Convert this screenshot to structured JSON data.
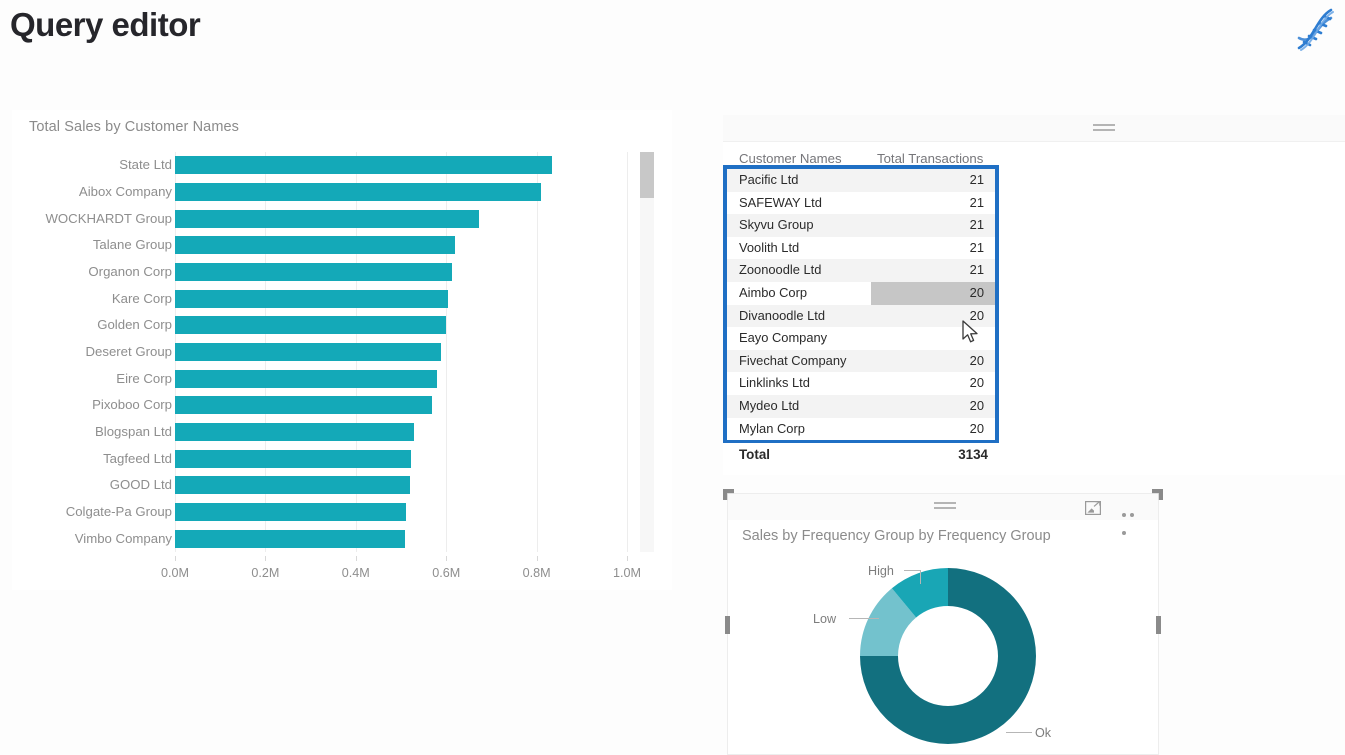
{
  "header": {
    "title": "Query editor",
    "logo_icon": "dna-helix-icon",
    "logo_color": "#2e7dd1"
  },
  "bar_panel": {
    "title": "Total Sales by Customer Names",
    "scrollbar_icon": "vertical-scrollbar"
  },
  "table_panel": {
    "columns": [
      "Customer Names",
      "Total Transactions"
    ],
    "rows": [
      {
        "name": "Pacific Ltd",
        "value": "21",
        "highlighted": false
      },
      {
        "name": "SAFEWAY Ltd",
        "value": "21",
        "highlighted": false
      },
      {
        "name": "Skyvu Group",
        "value": "21",
        "highlighted": false
      },
      {
        "name": "Voolith Ltd",
        "value": "21",
        "highlighted": false
      },
      {
        "name": "Zoonoodle Ltd",
        "value": "21",
        "highlighted": false
      },
      {
        "name": "Aimbo Corp",
        "value": "20",
        "highlighted": true
      },
      {
        "name": "Divanoodle Ltd",
        "value": "20",
        "highlighted": false
      },
      {
        "name": "Eayo Company",
        "value": "",
        "highlighted": false
      },
      {
        "name": "Fivechat Company",
        "value": "20",
        "highlighted": false
      },
      {
        "name": "Linklinks Ltd",
        "value": "20",
        "highlighted": false
      },
      {
        "name": "Mydeo Ltd",
        "value": "20",
        "highlighted": false
      },
      {
        "name": "Mylan Corp",
        "value": "20",
        "highlighted": false
      }
    ],
    "total_label": "Total",
    "total_value": "3134",
    "focus_border_color": "#1f6fc4",
    "drag_handle_icon": "drag-handle-icon",
    "cursor_icon": "mouse-pointer-icon"
  },
  "donut_panel": {
    "title": "Sales by Frequency Group by Frequency Group",
    "drag_handle_icon": "drag-handle-icon",
    "focus_mode_icon": "focus-mode-icon",
    "more_options_icon": "more-options-icon"
  },
  "chart_data": [
    {
      "type": "bar",
      "title": "Total Sales by Customer Names",
      "orientation": "horizontal",
      "xlabel": "",
      "ylabel": "",
      "xlim": [
        0,
        1000000
      ],
      "xticks": [
        0,
        200000,
        400000,
        600000,
        800000,
        1000000
      ],
      "xticklabels": [
        "0.0M",
        "0.2M",
        "0.4M",
        "0.6M",
        "0.8M",
        "1.0M"
      ],
      "grid": true,
      "legend": "none",
      "bar_color": "#14a9b8",
      "categories": [
        "State Ltd",
        "Aibox Company",
        "WOCKHARDT Group",
        "Talane Group",
        "Organon Corp",
        "Kare Corp",
        "Golden Corp",
        "Deseret Group",
        "Eire Corp",
        "Pixoboo Corp",
        "Blogspan Ltd",
        "Tagfeed Ltd",
        "GOOD Ltd",
        "Colgate-Pa Group",
        "Vimbo Company"
      ],
      "values": [
        835000,
        810000,
        673000,
        620000,
        613000,
        605000,
        600000,
        588000,
        580000,
        568000,
        528000,
        522000,
        520000,
        512000,
        508000
      ]
    },
    {
      "type": "pie",
      "subtype": "donut",
      "title": "Sales by Frequency Group by Frequency Group",
      "labels": [
        "Ok",
        "Low",
        "High"
      ],
      "values": [
        75,
        14,
        11
      ],
      "colors": [
        "#12707f",
        "#73c2cd",
        "#19a6b5"
      ],
      "legend": "none",
      "annotations": [
        "High",
        "Low",
        "Ok"
      ]
    },
    {
      "type": "table",
      "title": "Customer Transactions",
      "columns": [
        "Customer Names",
        "Total Transactions"
      ],
      "rows": [
        [
          "Pacific Ltd",
          21
        ],
        [
          "SAFEWAY Ltd",
          21
        ],
        [
          "Skyvu Group",
          21
        ],
        [
          "Voolith Ltd",
          21
        ],
        [
          "Zoonoodle Ltd",
          21
        ],
        [
          "Aimbo Corp",
          20
        ],
        [
          "Divanoodle Ltd",
          20
        ],
        [
          "Eayo Company",
          null
        ],
        [
          "Fivechat Company",
          20
        ],
        [
          "Linklinks Ltd",
          20
        ],
        [
          "Mydeo Ltd",
          20
        ],
        [
          "Mylan Corp",
          20
        ]
      ],
      "total": 3134
    }
  ]
}
